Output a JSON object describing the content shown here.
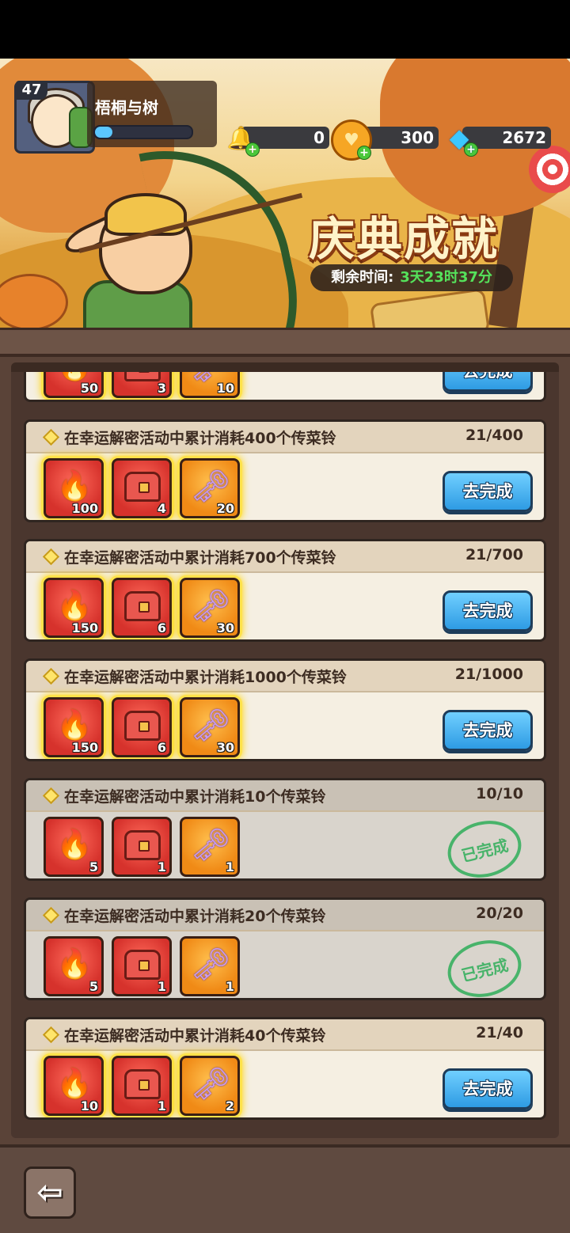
{
  "player": {
    "level": "47",
    "name": "梧桐与树",
    "exp_fraction": 0.18
  },
  "currencies": [
    {
      "name": "bell",
      "value": "0"
    },
    {
      "name": "coin",
      "value": "300"
    },
    {
      "name": "diamond",
      "value": "2672"
    }
  ],
  "event": {
    "title": "庆典成就",
    "time_label": "剩余时间:",
    "time_value": "3天23时37分"
  },
  "tasks": [
    {
      "title": "",
      "progress": "",
      "rewards": [
        "50",
        "3",
        "10"
      ],
      "button": "去完成",
      "completed": false
    },
    {
      "title": "在幸运解密活动中累计消耗400个传菜铃",
      "progress": "21/400",
      "rewards": [
        "100",
        "4",
        "20"
      ],
      "button": "去完成",
      "completed": false
    },
    {
      "title": "在幸运解密活动中累计消耗700个传菜铃",
      "progress": "21/700",
      "rewards": [
        "150",
        "6",
        "30"
      ],
      "button": "去完成",
      "completed": false
    },
    {
      "title": "在幸运解密活动中累计消耗1000个传菜铃",
      "progress": "21/1000",
      "rewards": [
        "150",
        "6",
        "30"
      ],
      "button": "去完成",
      "completed": false
    },
    {
      "title": "在幸运解密活动中累计消耗10个传菜铃",
      "progress": "10/10",
      "rewards": [
        "5",
        "1",
        "1"
      ],
      "stamp": "已完成",
      "completed": true
    },
    {
      "title": "在幸运解密活动中累计消耗20个传菜铃",
      "progress": "20/20",
      "rewards": [
        "5",
        "1",
        "1"
      ],
      "stamp": "已完成",
      "completed": true
    },
    {
      "title": "在幸运解密活动中累计消耗40个传菜铃",
      "progress": "21/40",
      "rewards": [
        "10",
        "1",
        "2"
      ],
      "button": "去完成",
      "completed": false
    }
  ],
  "icons": {
    "back": "back-arrow-icon",
    "fire": "fire-icon",
    "chest": "chest-icon",
    "key": "key-icon"
  },
  "colors": {
    "accent_button": "#2e9be3",
    "completed_stamp": "#2fae5a",
    "time_green": "#55e25b"
  }
}
